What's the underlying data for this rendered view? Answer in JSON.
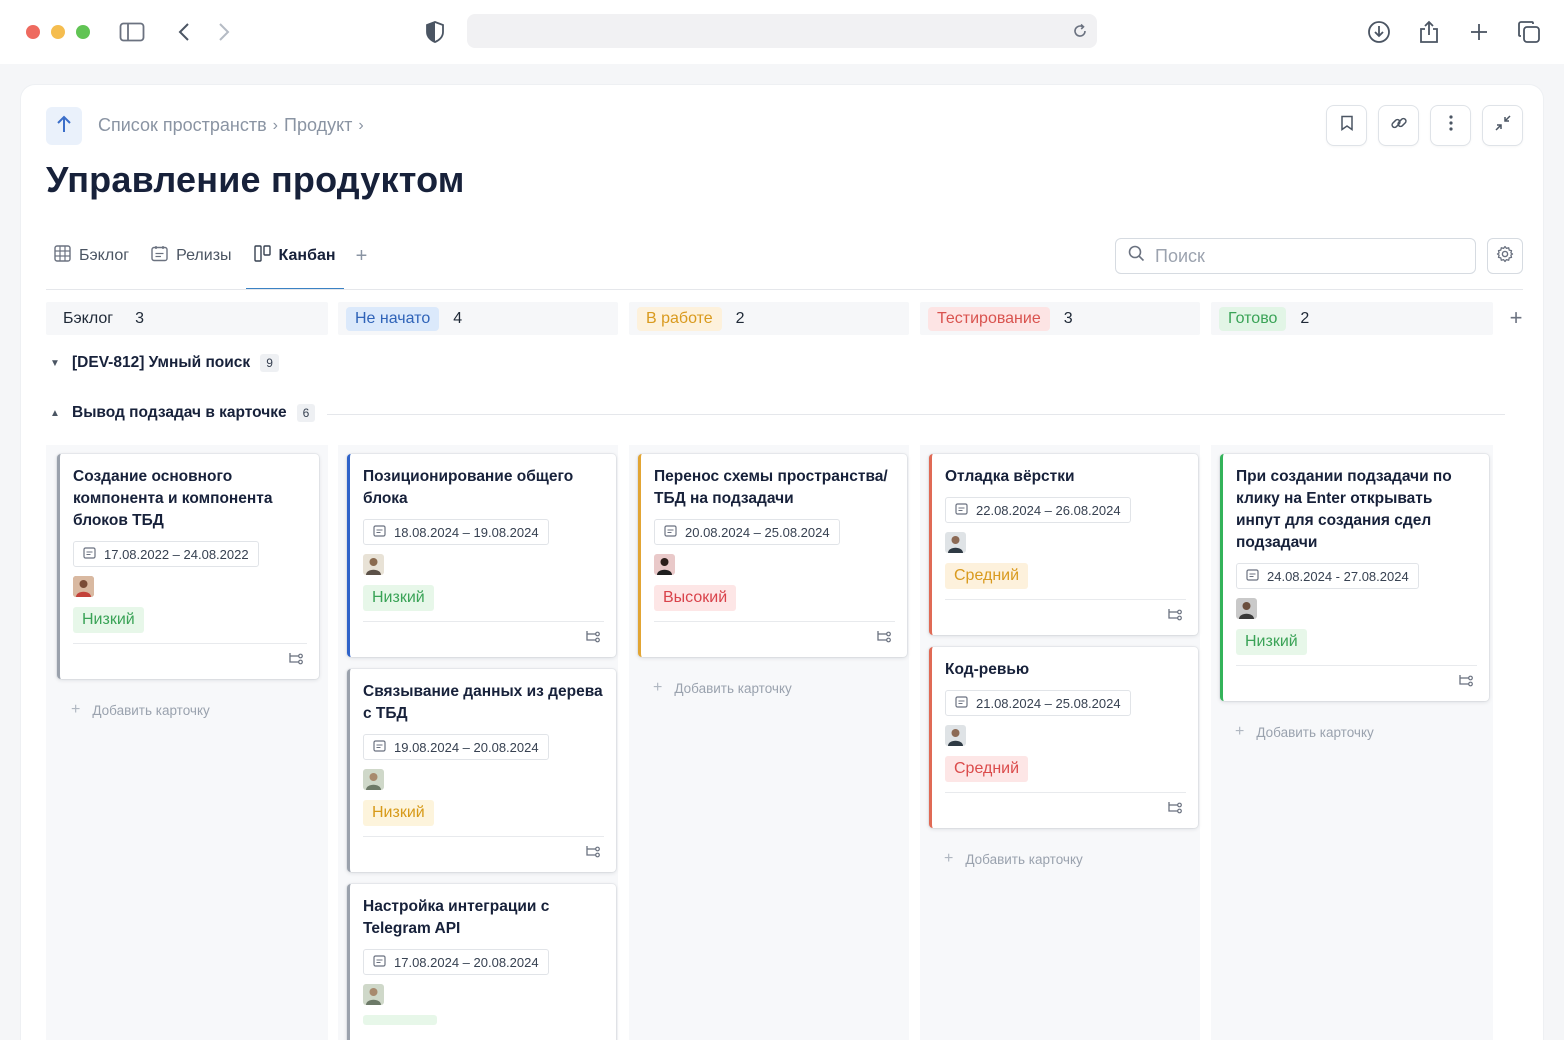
{
  "breadcrumbs": [
    "Список пространств",
    "Продукт"
  ],
  "page_title": "Управление продуктом",
  "tabs": [
    {
      "label": "Бэклог",
      "icon": "grid-table-icon"
    },
    {
      "label": "Релизы",
      "icon": "calendar-list-icon"
    },
    {
      "label": "Канбан",
      "icon": "kanban-icon",
      "active": true
    }
  ],
  "search": {
    "placeholder": "Поиск"
  },
  "columns": [
    {
      "label": "Бэклог",
      "count": "3",
      "color": "#f6f7f9",
      "text_color": "#1f2937"
    },
    {
      "label": "Не начато",
      "count": "4",
      "color": "#dbe9fb",
      "text_color": "#2f63b8"
    },
    {
      "label": "В работе",
      "count": "2",
      "color": "#fdf1dc",
      "text_color": "#d99a1e"
    },
    {
      "label": "Тестирование",
      "count": "3",
      "color": "#fde4e4",
      "text_color": "#d9534f"
    },
    {
      "label": "Готово",
      "count": "2",
      "color": "#e2f5e6",
      "text_color": "#3aa357"
    }
  ],
  "groups": [
    {
      "label": "[DEV-812] Умный поиск",
      "count": "9",
      "expanded": false
    },
    {
      "label": "Вывод подзадач в карточке",
      "count": "6",
      "expanded": true
    }
  ],
  "cards": {
    "c1": {
      "title": "Создание основного компонента и компонента блоков ТБД",
      "date": "17.08.2022 – 24.08.2022",
      "priority": "Низкий"
    },
    "c2": {
      "title": "Позиционирование общего блока",
      "date": "18.08.2024 – 19.08.2024",
      "priority": "Низкий"
    },
    "c3": {
      "title": "Связывание данных из дерева с ТБД",
      "date": "19.08.2024 – 20.08.2024",
      "priority": "Низкий"
    },
    "c4": {
      "title": "Настройка интеграции с Telegram API",
      "date": "17.08.2024 – 20.08.2024"
    },
    "c5": {
      "title": "Перенос схемы пространства/ ТБД на подзадачи",
      "date": "20.08.2024 – 25.08.2024",
      "priority": "Высокий"
    },
    "c6": {
      "title": "Отладка вёрстки",
      "date": "22.08.2024 – 26.08.2024",
      "priority": "Средний"
    },
    "c7": {
      "title": "Код-ревью",
      "date": "21.08.2024 – 25.08.2024",
      "priority": "Средний"
    },
    "c8": {
      "title": "При создании подзадачи по клику на Enter открывать инпут для создания сдел подзадачи",
      "date": "24.08.2024 - 27.08.2024",
      "priority": "Низкий"
    }
  },
  "add_card_label": "Добавить карточку"
}
